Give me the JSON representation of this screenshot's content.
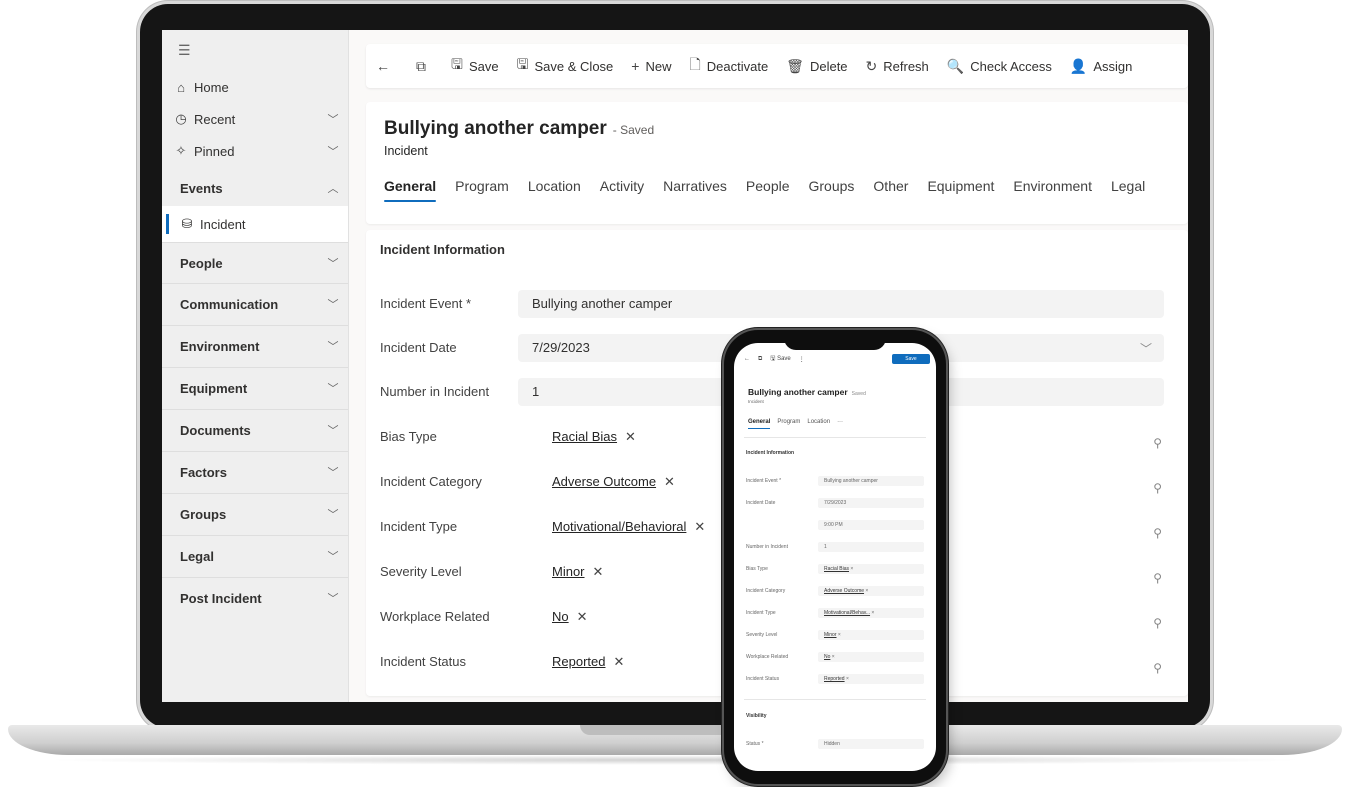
{
  "commands": [
    {
      "icon": "back-arrow-icon",
      "glyph": "←",
      "label": ""
    },
    {
      "icon": "popout-icon",
      "glyph": "⧉",
      "label": ""
    },
    {
      "icon": "save-icon",
      "glyph": "🖫",
      "label": "Save"
    },
    {
      "icon": "save-close-icon",
      "glyph": "🖫",
      "label": "Save & Close"
    },
    {
      "icon": "plus-icon",
      "glyph": "+",
      "label": "New"
    },
    {
      "icon": "deactivate-icon",
      "glyph": "🗋",
      "label": "Deactivate"
    },
    {
      "icon": "trash-icon",
      "glyph": "🗑",
      "label": "Delete"
    },
    {
      "icon": "refresh-icon",
      "glyph": "↻",
      "label": "Refresh"
    },
    {
      "icon": "check-access-icon",
      "glyph": "🔍",
      "label": "Check Access"
    },
    {
      "icon": "assign-icon",
      "glyph": "👤",
      "label": "Assign"
    }
  ],
  "sidebar": {
    "top_items": [
      {
        "icon": "home-icon",
        "glyph": "⌂",
        "label": "Home",
        "chevron": ""
      },
      {
        "icon": "clock-icon",
        "glyph": "◷",
        "label": "Recent",
        "chevron": "﹀"
      },
      {
        "icon": "pin-icon",
        "glyph": "✧",
        "label": "Pinned",
        "chevron": "﹀"
      }
    ],
    "events_group": {
      "label": "Events",
      "chevron": "︿"
    },
    "selected_item": {
      "icon": "database-icon",
      "glyph": "⛁",
      "label": "Incident"
    },
    "groups": [
      {
        "label": "People",
        "chevron": "﹀"
      },
      {
        "label": "Communication",
        "chevron": "﹀"
      },
      {
        "label": "Environment",
        "chevron": "﹀"
      },
      {
        "label": "Equipment",
        "chevron": "﹀"
      },
      {
        "label": "Documents",
        "chevron": "﹀"
      },
      {
        "label": "Factors",
        "chevron": "﹀"
      },
      {
        "label": "Groups",
        "chevron": "﹀"
      },
      {
        "label": "Legal",
        "chevron": "﹀"
      },
      {
        "label": "Post Incident",
        "chevron": "﹀"
      }
    ]
  },
  "record": {
    "title": "Bullying another camper",
    "status": "- Saved",
    "entity": "Incident"
  },
  "tabs": [
    "General",
    "Program",
    "Location",
    "Activity",
    "Narratives",
    "People",
    "Groups",
    "Other",
    "Equipment",
    "Environment",
    "Legal"
  ],
  "section": {
    "title": "Incident Information",
    "fields": [
      {
        "label": "Incident Event *",
        "value": "Bullying another camper",
        "kind": "text"
      },
      {
        "label": "Incident Date",
        "value": "7/29/2023",
        "kind": "dropdown"
      },
      {
        "label": "Number in Incident",
        "value": "1",
        "kind": "text"
      },
      {
        "label": "Bias Type",
        "value": "Racial Bias",
        "kind": "lookup"
      },
      {
        "label": "Incident Category",
        "value": "Adverse Outcome",
        "kind": "lookup"
      },
      {
        "label": "Incident Type",
        "value": "Motivational/Behavioral",
        "kind": "lookup"
      },
      {
        "label": "Severity Level",
        "value": "Minor",
        "kind": "lookup"
      },
      {
        "label": "Workplace Related",
        "value": "No",
        "kind": "lookup"
      },
      {
        "label": "Incident Status",
        "value": "Reported",
        "kind": "lookup"
      }
    ]
  },
  "phone": {
    "cmd_save": "Save",
    "primary_button": "Save",
    "title": "Bullying another camper",
    "status": "Saved",
    "entity": "Incident",
    "tabs": [
      "General",
      "Program",
      "Location",
      "···"
    ],
    "section_title": "Incident Information",
    "fields": [
      {
        "label": "Incident Event *",
        "value": "Bullying another camper"
      },
      {
        "label": "Incident Date",
        "value": "7/29/2023"
      },
      {
        "label": "",
        "value": "9:00 PM"
      },
      {
        "label": "Number in Incident",
        "value": "1"
      },
      {
        "label": "Bias Type",
        "value": "Racial Bias"
      },
      {
        "label": "Incident Category",
        "value": "Adverse Outcome"
      },
      {
        "label": "Incident Type",
        "value": "Motivational/Behav..."
      },
      {
        "label": "Severity Level",
        "value": "Minor"
      },
      {
        "label": "Workplace Related",
        "value": "No"
      },
      {
        "label": "Incident Status",
        "value": "Reported"
      }
    ],
    "visibility_title": "Visibility",
    "status_label": "Status *",
    "status_value": "Hidden"
  },
  "colors": {
    "accent": "#0f6cbd",
    "sidebar_bg": "#efefef",
    "bezel": "#151515"
  }
}
